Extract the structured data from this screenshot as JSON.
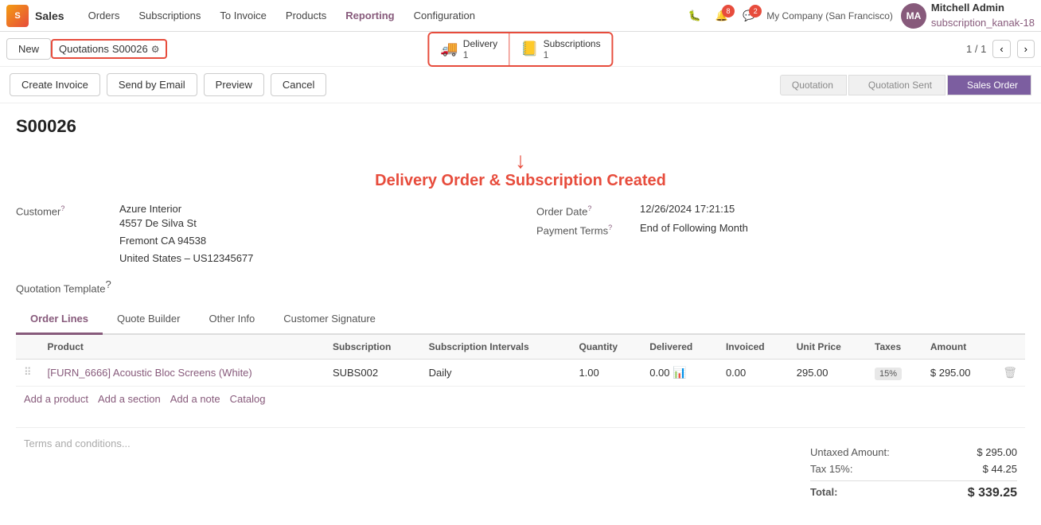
{
  "app": {
    "logo_text": "S",
    "app_name": "Sales"
  },
  "nav": {
    "items": [
      {
        "id": "orders",
        "label": "Orders",
        "active": false
      },
      {
        "id": "subscriptions",
        "label": "Subscriptions",
        "active": false
      },
      {
        "id": "to-invoice",
        "label": "To Invoice",
        "active": false
      },
      {
        "id": "products",
        "label": "Products",
        "active": false
      },
      {
        "id": "reporting",
        "label": "Reporting",
        "active": false
      },
      {
        "id": "configuration",
        "label": "Configuration",
        "active": false
      }
    ],
    "notification_count": "8",
    "chat_count": "2",
    "company": "My Company (San Francisco)",
    "user_name": "Mitchell Admin",
    "user_sub": "subscription_kanak-18",
    "user_initials": "MA"
  },
  "breadcrumb": {
    "new_label": "New",
    "current_label": "Quotations",
    "order_ref": "S00026",
    "gear_icon": "⚙"
  },
  "smart_buttons": {
    "delivery_label": "Delivery",
    "delivery_count": "1",
    "subscriptions_label": "Subscriptions",
    "subscriptions_count": "1"
  },
  "pagination": {
    "current": "1 / 1",
    "prev": "‹",
    "next": "›"
  },
  "toolbar": {
    "create_invoice": "Create Invoice",
    "send_by_email": "Send by Email",
    "preview": "Preview",
    "cancel": "Cancel"
  },
  "status_steps": [
    {
      "id": "quotation",
      "label": "Quotation",
      "active": false
    },
    {
      "id": "quotation-sent",
      "label": "Quotation Sent",
      "active": false
    },
    {
      "id": "sales-order",
      "label": "Sales Order",
      "active": true
    }
  ],
  "order": {
    "ref": "S00026",
    "annotation_text": "Delivery Order & Subscription Created",
    "customer_label": "Customer",
    "customer_name": "Azure Interior",
    "customer_address_line1": "4557 De Silva St",
    "customer_address_line2": "Fremont CA 94538",
    "customer_address_line3": "United States – US12345677",
    "order_date_label": "Order Date",
    "order_date_value": "12/26/2024 17:21:15",
    "payment_terms_label": "Payment Terms",
    "payment_terms_value": "End of Following Month",
    "quotation_template_label": "Quotation Template"
  },
  "tabs": [
    {
      "id": "order-lines",
      "label": "Order Lines",
      "active": true
    },
    {
      "id": "quote-builder",
      "label": "Quote Builder",
      "active": false
    },
    {
      "id": "other-info",
      "label": "Other Info",
      "active": false
    },
    {
      "id": "customer-signature",
      "label": "Customer Signature",
      "active": false
    }
  ],
  "table": {
    "columns": [
      {
        "id": "product",
        "label": "Product"
      },
      {
        "id": "subscription",
        "label": "Subscription"
      },
      {
        "id": "subscription-intervals",
        "label": "Subscription Intervals"
      },
      {
        "id": "quantity",
        "label": "Quantity"
      },
      {
        "id": "delivered",
        "label": "Delivered"
      },
      {
        "id": "invoiced",
        "label": "Invoiced"
      },
      {
        "id": "unit-price",
        "label": "Unit Price"
      },
      {
        "id": "taxes",
        "label": "Taxes"
      },
      {
        "id": "amount",
        "label": "Amount"
      }
    ],
    "rows": [
      {
        "product_name": "[FURN_6666] Acoustic Bloc Screens (White)",
        "subscription": "SUBS002",
        "subscription_intervals": "Daily",
        "quantity": "1.00",
        "delivered": "0.00",
        "invoiced": "0.00",
        "unit_price": "295.00",
        "taxes": "15%",
        "amount": "$ 295.00"
      }
    ]
  },
  "add_row": {
    "add_product": "Add a product",
    "add_section": "Add a section",
    "add_note": "Add a note",
    "catalog": "Catalog"
  },
  "footer": {
    "terms_placeholder": "Terms and conditions...",
    "untaxed_label": "Untaxed Amount:",
    "untaxed_value": "$ 295.00",
    "tax_label": "Tax 15%:",
    "tax_value": "$ 44.25",
    "total_label": "Total:",
    "total_value": "$ 339.25"
  }
}
